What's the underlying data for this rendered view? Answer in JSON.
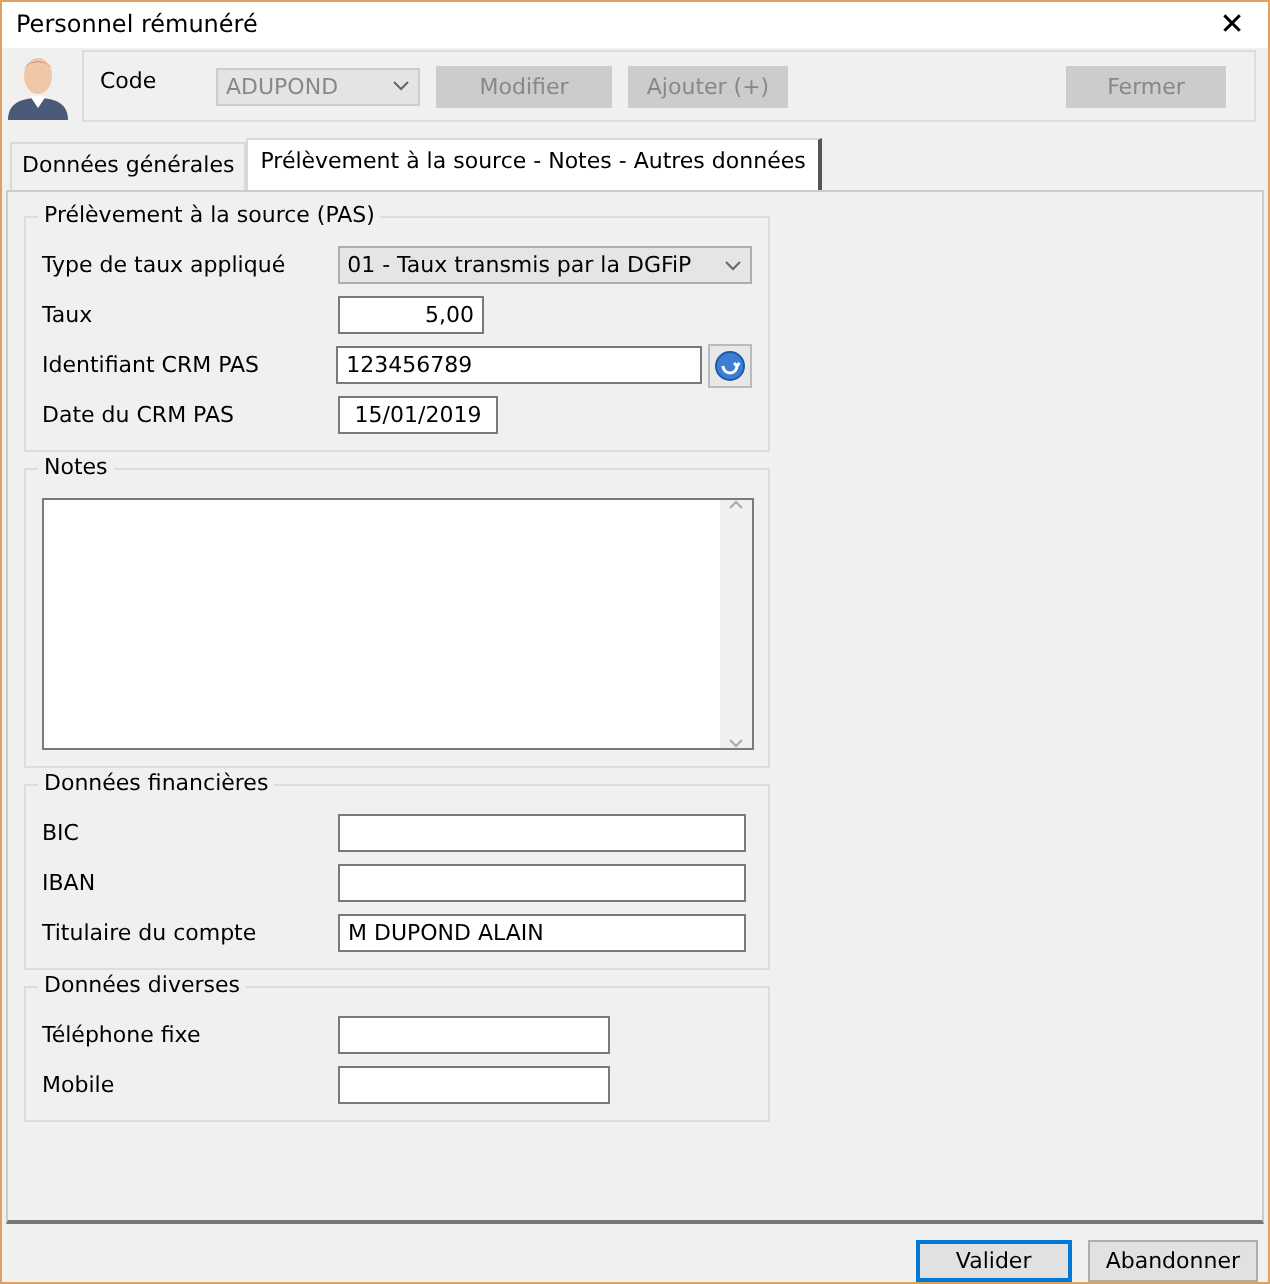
{
  "window": {
    "title": "Personnel rémunéré",
    "close": "✕"
  },
  "toolbar": {
    "code_label": "Code",
    "code_select": {
      "value": "ADUPOND",
      "disabled": true
    },
    "buttons": [
      {
        "label": "Modifier",
        "disabled": true
      },
      {
        "label": "Ajouter (+)",
        "disabled": true
      },
      {
        "label": "Fermer",
        "disabled": true
      }
    ]
  },
  "tabs": [
    {
      "label": "Données générales",
      "selected": false
    },
    {
      "label": "Prélèvement à la source -  Notes - Autres données",
      "selected": true
    }
  ],
  "groups": [
    {
      "title": "Prélèvement à la source (PAS)",
      "fields": [
        {
          "kind": "select",
          "label": "Type de taux appliqué",
          "value": "01 - Taux transmis par la DGFiP"
        },
        {
          "kind": "number",
          "label": "Taux",
          "value": "5,00"
        },
        {
          "kind": "lookup",
          "label": "Identifiant CRM PAS",
          "value": "123456789"
        },
        {
          "kind": "date",
          "label": "Date du CRM PAS",
          "value": "15/01/2019"
        }
      ]
    },
    {
      "title": "Notes",
      "fields": [
        {
          "kind": "memo"
        }
      ]
    },
    {
      "title": "Données financières",
      "fields": [
        {
          "kind": "text",
          "label": "BIC"
        },
        {
          "kind": "text",
          "label": "IBAN"
        },
        {
          "kind": "text",
          "label": "Titulaire du compte",
          "value": "M DUPOND ALAIN"
        }
      ]
    },
    {
      "title": "Données diverses",
      "fields": [
        {
          "kind": "short",
          "label": "Téléphone fixe"
        },
        {
          "kind": "short",
          "label": "Mobile"
        }
      ]
    }
  ],
  "footer_buttons": [
    {
      "label": "Valider",
      "focused": true
    },
    {
      "label": "Abandonner",
      "focused": false
    }
  ]
}
